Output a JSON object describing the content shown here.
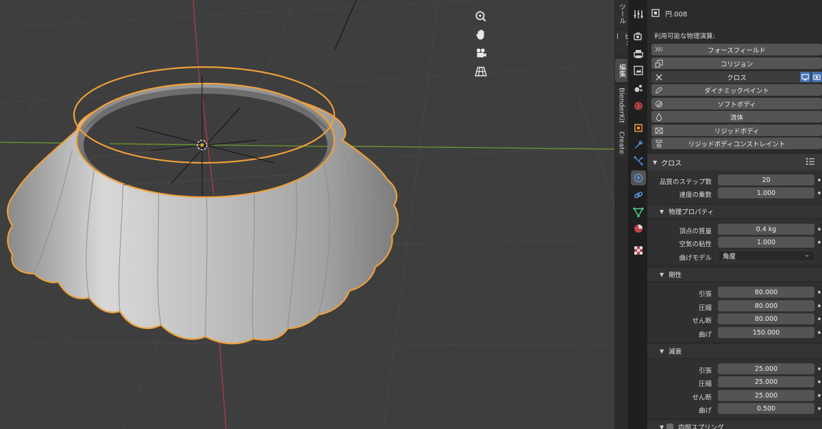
{
  "ntabs": [
    "ツール",
    "ビュー",
    "編集",
    "BlenderKit",
    "Create"
  ],
  "object": {
    "name": "円.008",
    "icon": "mesh-object-icon"
  },
  "physics": {
    "heading": "利用可能な物理演算:",
    "buttons": [
      {
        "label": "フォースフィールド",
        "icon": "force-field-icon",
        "enabled": false
      },
      {
        "label": "コリジョン",
        "icon": "collision-icon",
        "enabled": false
      },
      {
        "label": "クロス",
        "icon": "close-icon",
        "enabled": true
      },
      {
        "label": "ダイナミックペイント",
        "icon": "dynamic-paint-icon",
        "enabled": false
      },
      {
        "label": "ソフトボディ",
        "icon": "soft-body-icon",
        "enabled": false
      },
      {
        "label": "流体",
        "icon": "fluid-icon",
        "enabled": false
      },
      {
        "label": "リジッドボディ",
        "icon": "rigid-body-icon",
        "enabled": false
      },
      {
        "label": "リジッドボディコンストレイント",
        "icon": "rigid-constraint-icon",
        "enabled": false
      }
    ]
  },
  "cloth": {
    "title": "クロス",
    "quality_label": "品質のステップ数",
    "quality_value": "20",
    "speed_label": "速度の乗数",
    "speed_value": "1.000",
    "physprops": {
      "title": "物理プロパティ",
      "mass_label": "頂点の質量",
      "mass_value": "0.4 kg",
      "air_label": "空気の粘性",
      "air_value": "1.000",
      "bend_model_label": "曲げモデル",
      "bend_model_value": "角度"
    },
    "stiffness": {
      "title": "剛性",
      "rows": [
        {
          "label": "引張",
          "value": "80.000"
        },
        {
          "label": "圧縮",
          "value": "80.000"
        },
        {
          "label": "せん断",
          "value": "80.000"
        },
        {
          "label": "曲げ",
          "value": "150.000"
        }
      ]
    },
    "damping": {
      "title": "減衰",
      "rows": [
        {
          "label": "引張",
          "value": "25.000"
        },
        {
          "label": "圧縮",
          "value": "25.000"
        },
        {
          "label": "せん断",
          "value": "25.000"
        },
        {
          "label": "曲げ",
          "value": "0.500"
        }
      ]
    },
    "internal_springs_title": "内部スプリング"
  },
  "colors": {
    "accent_blue": "#4772b3",
    "selection_orange": "#f5a13a",
    "x_axis": "#c8414b",
    "y_axis": "#8bbd3a"
  }
}
